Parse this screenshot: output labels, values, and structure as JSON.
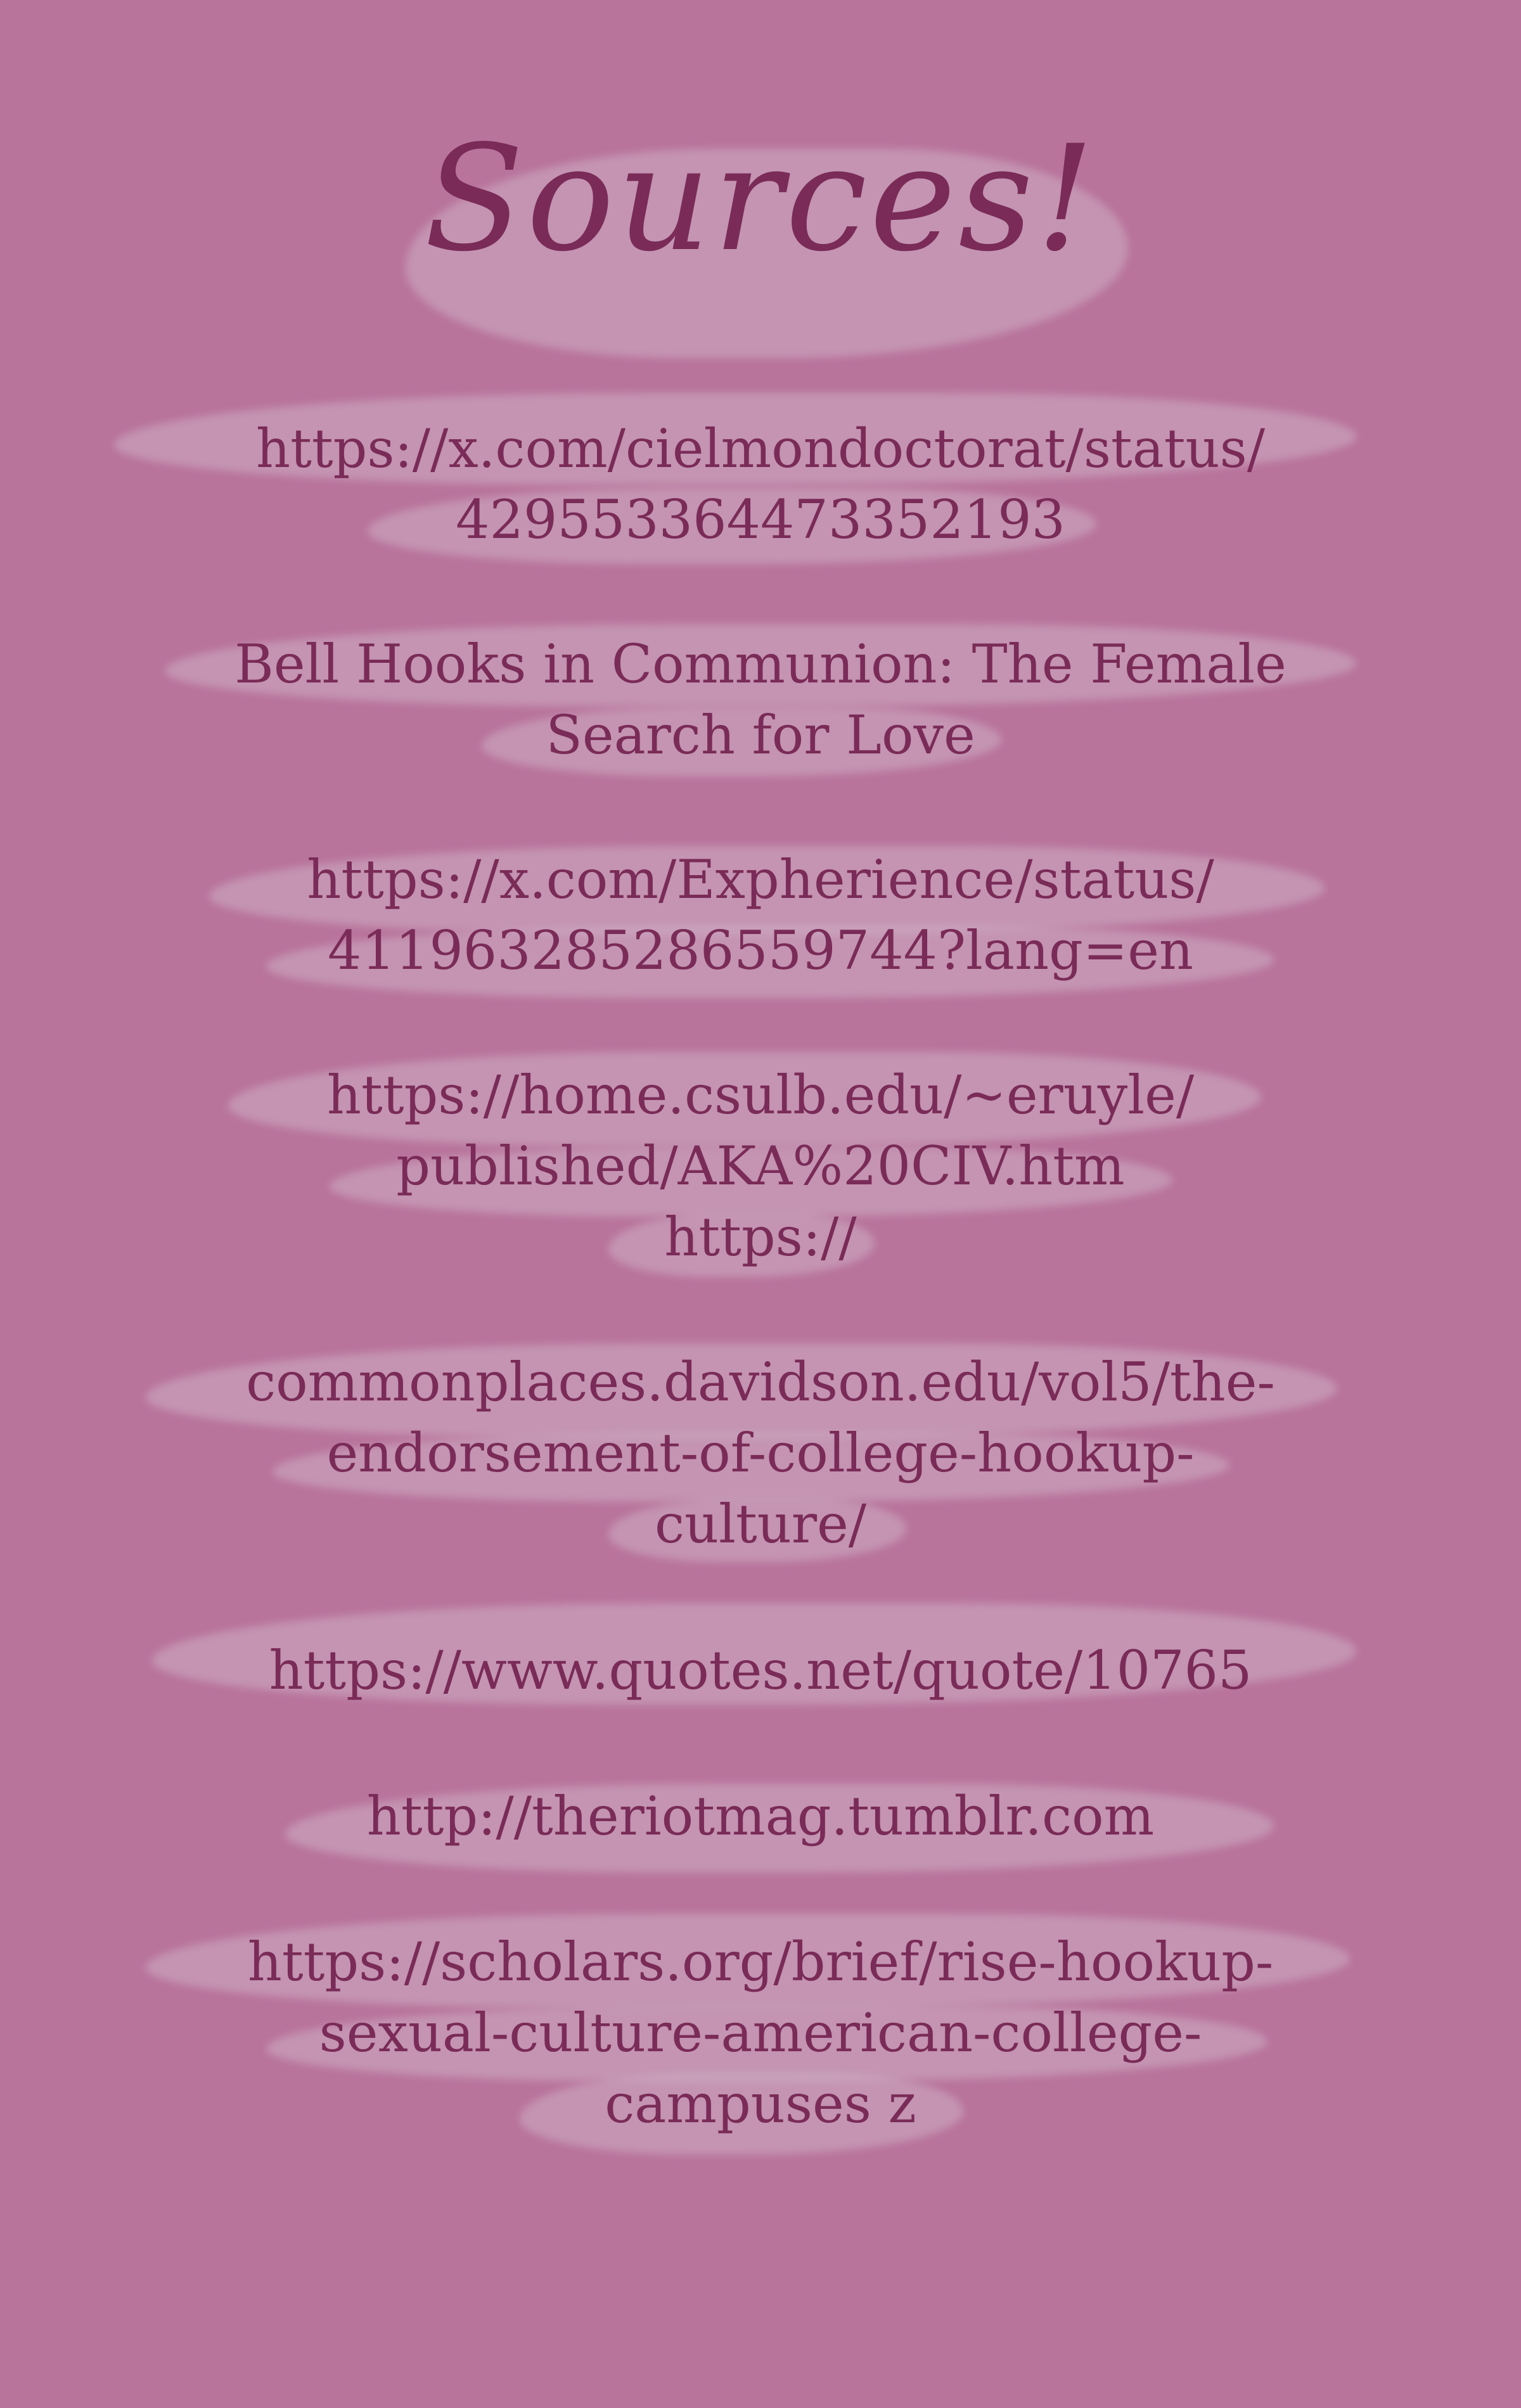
{
  "title": "Sources!",
  "sources": [
    {
      "lines": [
        "https://x.com/cielmondoctorat/status/",
        "429553364473352193"
      ]
    },
    {
      "lines": [
        "Bell Hooks in Communion: The Female",
        "Search for Love"
      ]
    },
    {
      "lines": [
        "https://x.com/Expherience/status/",
        "411963285286559744?lang=en"
      ]
    },
    {
      "lines": [
        "https://home.csulb.edu/~eruyle/",
        "published/AKA%20CIV.htm",
        "https://"
      ]
    },
    {
      "lines": [
        "commonplaces.davidson.edu/vol5/the-",
        "endorsement-of-college-hookup-",
        "culture/"
      ]
    },
    {
      "lines": [
        "https://www.quotes.net/quote/10765"
      ]
    },
    {
      "lines": [
        "http://theriotmag.tumblr.com"
      ]
    },
    {
      "lines": [
        "https://scholars.org/brief/rise-hookup-",
        "sexual-culture-american-college-",
        "campuses z"
      ]
    }
  ],
  "colors": {
    "background": "#b9749c",
    "text": "#7a2b57",
    "brush": "#ceaec4"
  }
}
